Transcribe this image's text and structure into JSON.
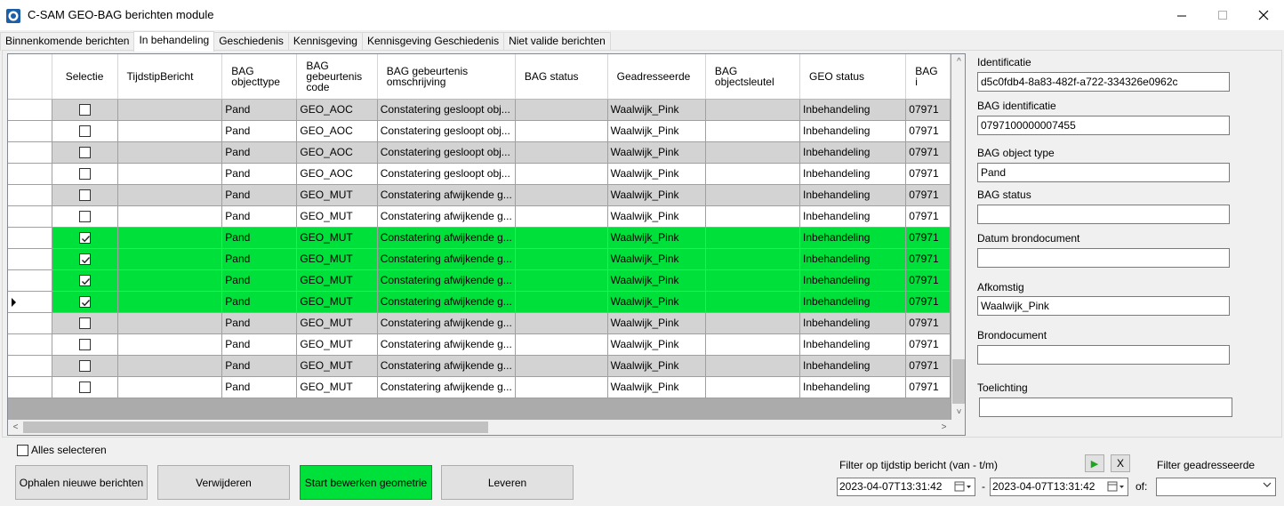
{
  "window": {
    "title": "C-SAM GEO-BAG berichten module",
    "controls": {
      "minimize": "—",
      "maximize": "☐",
      "close": "✕"
    }
  },
  "tabs": [
    {
      "label": "Binnenkomende berichten",
      "active": false
    },
    {
      "label": "In behandeling",
      "active": true
    },
    {
      "label": "Geschiedenis",
      "active": false
    },
    {
      "label": "Kennisgeving",
      "active": false
    },
    {
      "label": "Kennisgeving Geschiedenis",
      "active": false
    },
    {
      "label": "Niet valide berichten",
      "active": false
    }
  ],
  "grid": {
    "columns": [
      {
        "label": ""
      },
      {
        "label": "Selectie"
      },
      {
        "label": "TijdstipBericht"
      },
      {
        "label": "BAG objecttype"
      },
      {
        "label": "BAG gebeurtenis code"
      },
      {
        "label": "BAG gebeurtenis omschrijving"
      },
      {
        "label": "BAG status"
      },
      {
        "label": "Geadresseerde"
      },
      {
        "label": "BAG objectsleutel"
      },
      {
        "label": "GEO status"
      },
      {
        "label": "BAG i"
      }
    ],
    "rows": [
      {
        "checked": false,
        "style": "alt",
        "current": false,
        "tijdstip": "",
        "objecttype": "Pand",
        "code": "GEO_AOC",
        "omschrijving": "Constatering gesloopt obj...",
        "status": "",
        "geadresseerde": "Waalwijk_Pink",
        "sleutel": "",
        "geo_status": "Inbehandeling",
        "bag_id": "07971"
      },
      {
        "checked": false,
        "style": "normal",
        "current": false,
        "tijdstip": "",
        "objecttype": "Pand",
        "code": "GEO_AOC",
        "omschrijving": "Constatering gesloopt obj...",
        "status": "",
        "geadresseerde": "Waalwijk_Pink",
        "sleutel": "",
        "geo_status": "Inbehandeling",
        "bag_id": "07971"
      },
      {
        "checked": false,
        "style": "alt",
        "current": false,
        "tijdstip": "",
        "objecttype": "Pand",
        "code": "GEO_AOC",
        "omschrijving": "Constatering gesloopt obj...",
        "status": "",
        "geadresseerde": "Waalwijk_Pink",
        "sleutel": "",
        "geo_status": "Inbehandeling",
        "bag_id": "07971"
      },
      {
        "checked": false,
        "style": "normal",
        "current": false,
        "tijdstip": "",
        "objecttype": "Pand",
        "code": "GEO_AOC",
        "omschrijving": "Constatering gesloopt obj...",
        "status": "",
        "geadresseerde": "Waalwijk_Pink",
        "sleutel": "",
        "geo_status": "Inbehandeling",
        "bag_id": "07971"
      },
      {
        "checked": false,
        "style": "alt",
        "current": false,
        "tijdstip": "",
        "objecttype": "Pand",
        "code": "GEO_MUT",
        "omschrijving": "Constatering afwijkende g...",
        "status": "",
        "geadresseerde": "Waalwijk_Pink",
        "sleutel": "",
        "geo_status": "Inbehandeling",
        "bag_id": "07971"
      },
      {
        "checked": false,
        "style": "normal",
        "current": false,
        "tijdstip": "",
        "objecttype": "Pand",
        "code": "GEO_MUT",
        "omschrijving": "Constatering afwijkende g...",
        "status": "",
        "geadresseerde": "Waalwijk_Pink",
        "sleutel": "",
        "geo_status": "Inbehandeling",
        "bag_id": "07971"
      },
      {
        "checked": true,
        "style": "sel",
        "current": false,
        "tijdstip": "",
        "objecttype": "Pand",
        "code": "GEO_MUT",
        "omschrijving": "Constatering afwijkende g...",
        "status": "",
        "geadresseerde": "Waalwijk_Pink",
        "sleutel": "",
        "geo_status": "Inbehandeling",
        "bag_id": "07971"
      },
      {
        "checked": true,
        "style": "sel",
        "current": false,
        "tijdstip": "",
        "objecttype": "Pand",
        "code": "GEO_MUT",
        "omschrijving": "Constatering afwijkende g...",
        "status": "",
        "geadresseerde": "Waalwijk_Pink",
        "sleutel": "",
        "geo_status": "Inbehandeling",
        "bag_id": "07971"
      },
      {
        "checked": true,
        "style": "sel",
        "current": false,
        "tijdstip": "",
        "objecttype": "Pand",
        "code": "GEO_MUT",
        "omschrijving": "Constatering afwijkende g...",
        "status": "",
        "geadresseerde": "Waalwijk_Pink",
        "sleutel": "",
        "geo_status": "Inbehandeling",
        "bag_id": "07971"
      },
      {
        "checked": true,
        "style": "sel",
        "current": true,
        "tijdstip": "",
        "objecttype": "Pand",
        "code": "GEO_MUT",
        "omschrijving": "Constatering afwijkende g...",
        "status": "",
        "geadresseerde": "Waalwijk_Pink",
        "sleutel": "",
        "geo_status": "Inbehandeling",
        "bag_id": "07971"
      },
      {
        "checked": false,
        "style": "alt",
        "current": false,
        "tijdstip": "",
        "objecttype": "Pand",
        "code": "GEO_MUT",
        "omschrijving": "Constatering afwijkende g...",
        "status": "",
        "geadresseerde": "Waalwijk_Pink",
        "sleutel": "",
        "geo_status": "Inbehandeling",
        "bag_id": "07971"
      },
      {
        "checked": false,
        "style": "normal",
        "current": false,
        "tijdstip": "",
        "objecttype": "Pand",
        "code": "GEO_MUT",
        "omschrijving": "Constatering afwijkende g...",
        "status": "",
        "geadresseerde": "Waalwijk_Pink",
        "sleutel": "",
        "geo_status": "Inbehandeling",
        "bag_id": "07971"
      },
      {
        "checked": false,
        "style": "alt",
        "current": false,
        "tijdstip": "",
        "objecttype": "Pand",
        "code": "GEO_MUT",
        "omschrijving": "Constatering afwijkende g...",
        "status": "",
        "geadresseerde": "Waalwijk_Pink",
        "sleutel": "",
        "geo_status": "Inbehandeling",
        "bag_id": "07971"
      },
      {
        "checked": false,
        "style": "normal",
        "current": false,
        "tijdstip": "",
        "objecttype": "Pand",
        "code": "GEO_MUT",
        "omschrijving": "Constatering afwijkende g...",
        "status": "",
        "geadresseerde": "Waalwijk_Pink",
        "sleutel": "",
        "geo_status": "Inbehandeling",
        "bag_id": "07971"
      }
    ],
    "scroll": {
      "up": "^",
      "down": "˅",
      "left": "<",
      "right": ">"
    }
  },
  "details": {
    "identificatie_label": "Identificatie",
    "identificatie_value": "d5c0fdb4-8a83-482f-a722-334326e0962c",
    "bag_identificatie_label": "BAG identificatie",
    "bag_identificatie_value": "0797100000007455",
    "bag_object_type_label": "BAG object type",
    "bag_object_type_value": "Pand",
    "bag_status_label": "BAG status",
    "bag_status_value": "",
    "datum_label": "Datum brondocument",
    "datum_value": "",
    "afkomstig_label": "Afkomstig",
    "afkomstig_value": "Waalwijk_Pink",
    "brondocument_label": "Brondocument",
    "brondocument_value": "",
    "toelichting_label": "Toelichting",
    "toelichting_value": ""
  },
  "footer": {
    "alles_selecteren": "Alles selecteren",
    "buttons": {
      "ophalen": "Ophalen nieuwe berichten",
      "verwijderen": "Verwijderen",
      "start_bewerken": "Start bewerken geometrie",
      "leveren": "Leveren"
    },
    "filter_label": "Filter op tijdstip bericht (van - t/m)",
    "date_from": "2023-04-07T13:31:42",
    "date_sep": "-",
    "date_to": "2023-04-07T13:31:42",
    "of_label": "of:",
    "filter_geadresseerde_label": "Filter geadresseerde",
    "filter_geadresseerde_value": "",
    "play_glyph": "▶",
    "clear_glyph": "X"
  },
  "colors": {
    "selected_row": "#00e03a",
    "alt_row": "#d3d3d3",
    "accent_border": "#0078d7"
  }
}
